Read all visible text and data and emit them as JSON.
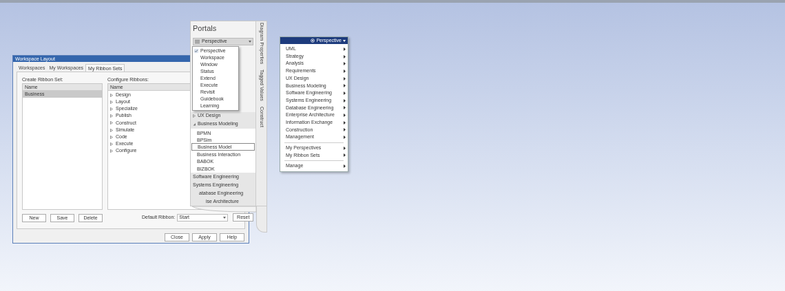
{
  "workspace_dialog": {
    "title": "Workspace Layout",
    "tabs": [
      {
        "label": "Workspaces",
        "selected": false
      },
      {
        "label": "My Workspaces",
        "selected": false
      },
      {
        "label": "My Ribbon Sets",
        "selected": true
      }
    ],
    "create_label": "Create Ribbon Set:",
    "ribbon_sets": {
      "column": "Name",
      "rows": [
        {
          "label": "Business",
          "selected": true
        }
      ]
    },
    "left_buttons": [
      "New",
      "Save",
      "Delete"
    ],
    "configure_label": "Configure Ribbons:",
    "ribbons": {
      "column": "Name",
      "items": [
        "Design",
        "Layout",
        "Specialize",
        "Publish",
        "Construct",
        "Simulate",
        "Code",
        "Execute",
        "Configure"
      ]
    },
    "default_ribbon": {
      "label": "Default Ribbon:",
      "value": "Start"
    },
    "reset_button": "Reset",
    "footer_buttons": [
      "Close",
      "Apply",
      "Help"
    ]
  },
  "portals": {
    "title": "Portals",
    "combo": "Perspective",
    "side_tabs": [
      "Diagram Properties",
      "Tagged Values",
      "Construct"
    ],
    "dropdown": [
      {
        "label": "Perspective",
        "checked": true
      },
      {
        "label": "Workspace",
        "checked": false
      },
      {
        "label": "Window",
        "checked": false
      },
      {
        "label": "Status",
        "checked": false
      },
      {
        "label": "Extend",
        "checked": false
      },
      {
        "label": "Execute",
        "checked": false
      },
      {
        "label": "Revisit",
        "checked": false
      },
      {
        "label": "Guidebook",
        "checked": false
      },
      {
        "label": "Learning",
        "checked": false
      }
    ],
    "tree": [
      {
        "label": "UX Design",
        "expanded": false
      },
      {
        "label": "Business Modeling",
        "expanded": true,
        "children": [
          {
            "label": "BPMN",
            "selected": false
          },
          {
            "label": "BPSim",
            "selected": false
          },
          {
            "label": "Business Model",
            "selected": true
          },
          {
            "label": "Business Interaction",
            "selected": false
          },
          {
            "label": "BABOK",
            "selected": false
          },
          {
            "label": "BIZBOK",
            "selected": false
          }
        ]
      },
      {
        "label": "Software Engineering"
      },
      {
        "label": "Systems Engineering"
      },
      {
        "label": "atabase Engineering"
      },
      {
        "label": "ise Architecture"
      }
    ]
  },
  "perspective_menu": {
    "title": "Perspective",
    "groups": [
      [
        "UML",
        "Strategy",
        "Analysis",
        "Requirements",
        "UX Design",
        "Business Modeling",
        "Software Engineering",
        "Systems Engineering",
        "Database Engineering",
        "Enterprise Architecture",
        "Information Exchange",
        "Construction",
        "Management"
      ],
      [
        "My Perspectives",
        "My Ribbon Sets"
      ],
      [
        "Manage"
      ]
    ]
  }
}
